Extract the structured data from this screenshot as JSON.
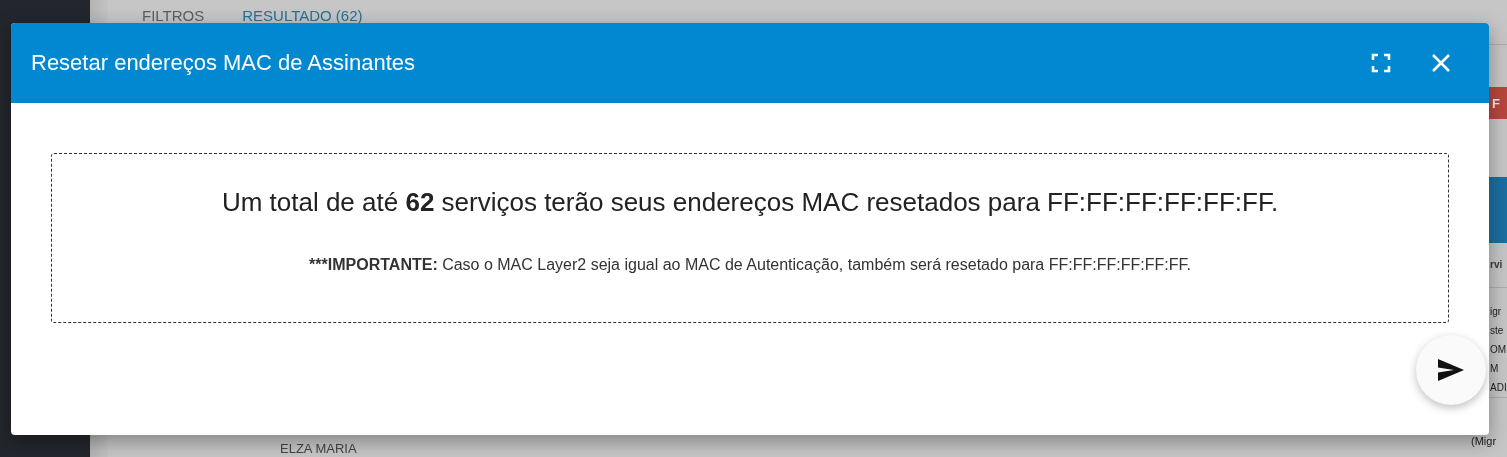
{
  "background": {
    "tabs": [
      {
        "label": "FILTROS",
        "selected": false
      },
      {
        "label": "RESULTADO (62)",
        "selected": true
      }
    ],
    "action_button": "F",
    "column_header": "rvi",
    "cell_fragments": [
      "igr",
      "ste",
      "OM",
      "M",
      "ADI"
    ],
    "row_fragment": "(Migr",
    "bottom_row": "ELZA MARIA"
  },
  "dialog": {
    "title": "Resetar endereços MAC de Assinantes",
    "message": "Um total de até **62** serviços terão seus endereços MAC resetados para FF:FF:FF:FF:FF:FF.",
    "note_label": "***IMPORTANTE:",
    "note_text": "Caso o MAC Layer2 seja igual ao MAC de Autenticação, também será resetado para FF:FF:FF:FF:FF:FF."
  }
}
